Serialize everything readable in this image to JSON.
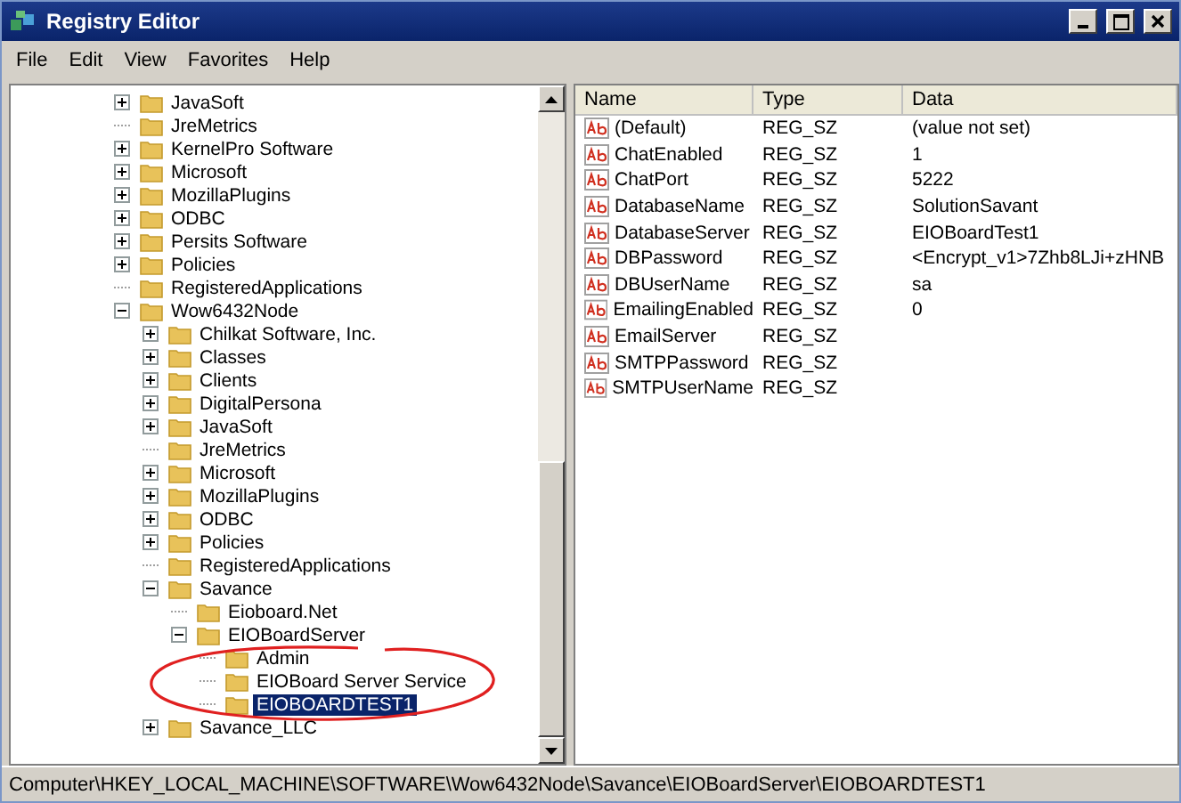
{
  "window": {
    "title": "Registry Editor"
  },
  "menu": [
    "File",
    "Edit",
    "View",
    "Favorites",
    "Help"
  ],
  "tree": {
    "items": [
      {
        "label": "JavaSoft",
        "expandable": true,
        "expanded": false,
        "selected": false
      },
      {
        "label": "JreMetrics",
        "expandable": false,
        "expanded": false,
        "selected": false
      },
      {
        "label": "KernelPro Software",
        "expandable": true,
        "expanded": false,
        "selected": false
      },
      {
        "label": "Microsoft",
        "expandable": true,
        "expanded": false,
        "selected": false
      },
      {
        "label": "MozillaPlugins",
        "expandable": true,
        "expanded": false,
        "selected": false
      },
      {
        "label": "ODBC",
        "expandable": true,
        "expanded": false,
        "selected": false
      },
      {
        "label": "Persits Software",
        "expandable": true,
        "expanded": false,
        "selected": false
      },
      {
        "label": "Policies",
        "expandable": true,
        "expanded": false,
        "selected": false
      },
      {
        "label": "RegisteredApplications",
        "expandable": false,
        "expanded": false,
        "selected": false
      },
      {
        "label": "Wow6432Node",
        "expandable": true,
        "expanded": true,
        "selected": false,
        "children": [
          {
            "label": "Chilkat Software, Inc.",
            "expandable": true,
            "expanded": false,
            "selected": false
          },
          {
            "label": "Classes",
            "expandable": true,
            "expanded": false,
            "selected": false
          },
          {
            "label": "Clients",
            "expandable": true,
            "expanded": false,
            "selected": false
          },
          {
            "label": "DigitalPersona",
            "expandable": true,
            "expanded": false,
            "selected": false
          },
          {
            "label": "JavaSoft",
            "expandable": true,
            "expanded": false,
            "selected": false
          },
          {
            "label": "JreMetrics",
            "expandable": false,
            "expanded": false,
            "selected": false
          },
          {
            "label": "Microsoft",
            "expandable": true,
            "expanded": false,
            "selected": false
          },
          {
            "label": "MozillaPlugins",
            "expandable": true,
            "expanded": false,
            "selected": false
          },
          {
            "label": "ODBC",
            "expandable": true,
            "expanded": false,
            "selected": false
          },
          {
            "label": "Policies",
            "expandable": true,
            "expanded": false,
            "selected": false
          },
          {
            "label": "RegisteredApplications",
            "expandable": false,
            "expanded": false,
            "selected": false
          },
          {
            "label": "Savance",
            "expandable": true,
            "expanded": true,
            "selected": false,
            "children": [
              {
                "label": "Eioboard.Net",
                "expandable": false,
                "expanded": false,
                "selected": false
              },
              {
                "label": "EIOBoardServer",
                "expandable": true,
                "expanded": true,
                "selected": false,
                "children": [
                  {
                    "label": "Admin",
                    "expandable": false,
                    "expanded": false,
                    "selected": false
                  },
                  {
                    "label": "EIOBoard Server Service",
                    "expandable": false,
                    "expanded": false,
                    "selected": false
                  },
                  {
                    "label": "EIOBOARDTEST1",
                    "expandable": false,
                    "expanded": false,
                    "selected": true
                  }
                ]
              }
            ]
          },
          {
            "label": "Savance_LLC",
            "expandable": true,
            "expanded": false,
            "selected": false
          }
        ]
      }
    ]
  },
  "values": {
    "columns": [
      "Name",
      "Type",
      "Data"
    ],
    "rows": [
      {
        "name": "(Default)",
        "type": "REG_SZ",
        "data": "(value not set)"
      },
      {
        "name": "ChatEnabled",
        "type": "REG_SZ",
        "data": "1"
      },
      {
        "name": "ChatPort",
        "type": "REG_SZ",
        "data": "5222"
      },
      {
        "name": "DatabaseName",
        "type": "REG_SZ",
        "data": "SolutionSavant"
      },
      {
        "name": "DatabaseServer",
        "type": "REG_SZ",
        "data": "EIOBoardTest1"
      },
      {
        "name": "DBPassword",
        "type": "REG_SZ",
        "data": "<Encrypt_v1>7Zhb8LJi+zHNB"
      },
      {
        "name": "DBUserName",
        "type": "REG_SZ",
        "data": "sa"
      },
      {
        "name": "EmailingEnabled",
        "type": "REG_SZ",
        "data": "0"
      },
      {
        "name": "EmailServer",
        "type": "REG_SZ"
      },
      {
        "name": "SMTPPassword",
        "type": "REG_SZ"
      },
      {
        "name": "SMTPUserName",
        "type": "REG_SZ"
      }
    ]
  },
  "status_bar": "Computer\\HKEY_LOCAL_MACHINE\\SOFTWARE\\Wow6432Node\\Savance\\EIOBoardServer\\EIOBOARDTEST1"
}
